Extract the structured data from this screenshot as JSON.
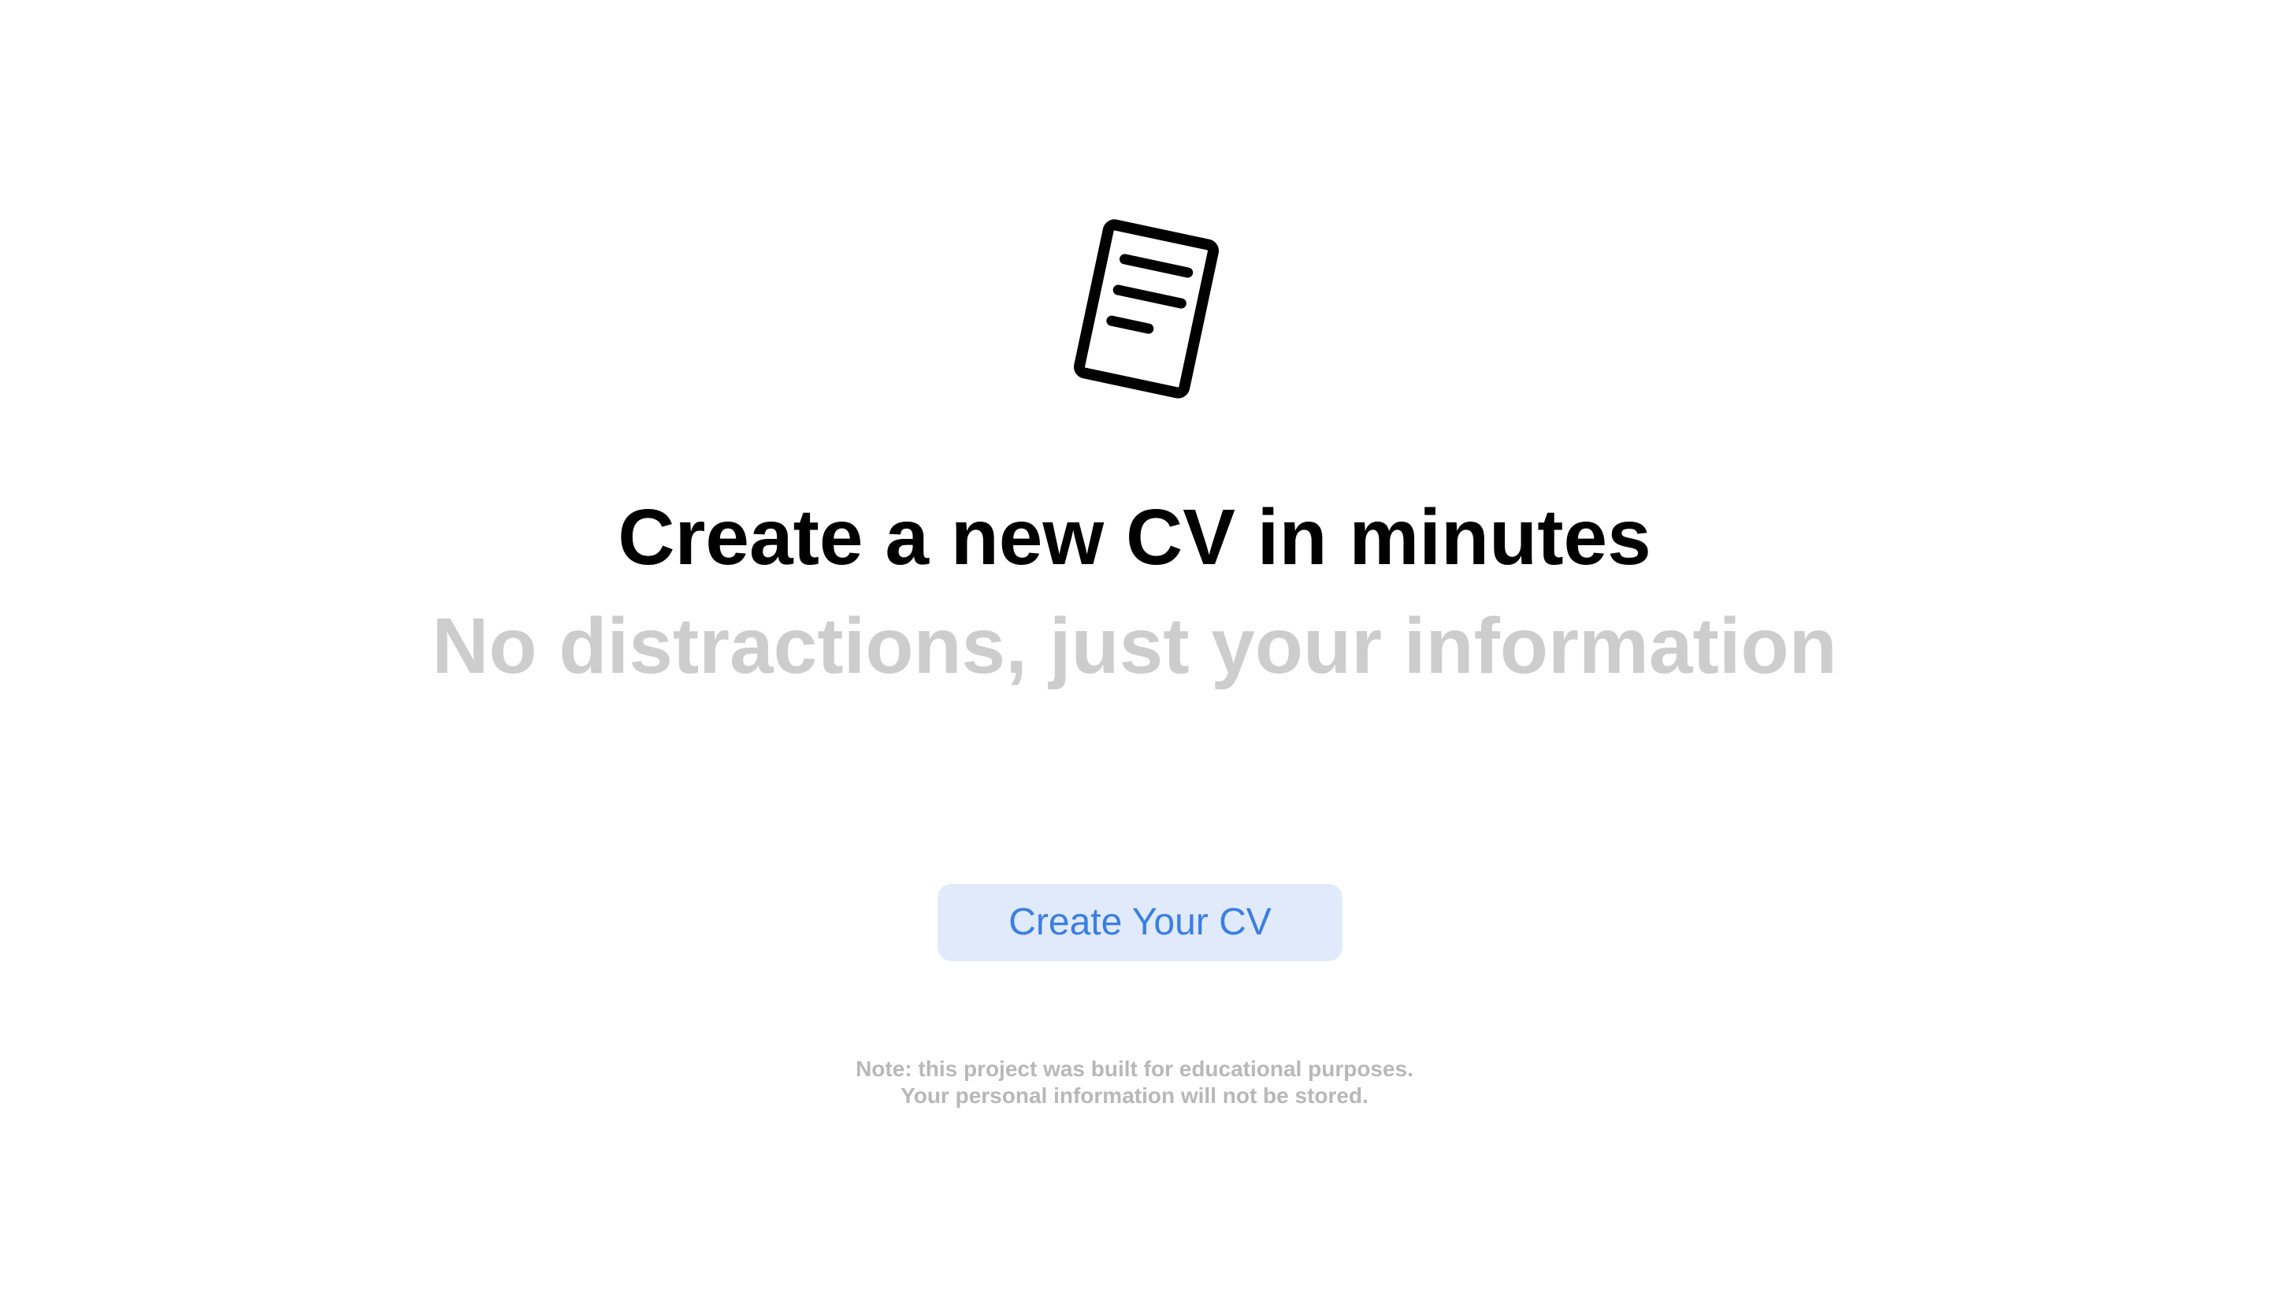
{
  "hero": {
    "icon": "document-icon",
    "title": "Create a new CV in minutes",
    "subtitle": "No distractions, just your information"
  },
  "cta": {
    "label": "Create Your CV"
  },
  "footer_note": {
    "line1": "Note: this project was built for educational purposes.",
    "line2": "Your personal information will not be stored."
  },
  "colors": {
    "title": "#000000",
    "subtitle": "#cdcdcd",
    "button_bg": "#e0eafb",
    "button_text": "#3a7ee3",
    "note": "#b8b8b8"
  }
}
